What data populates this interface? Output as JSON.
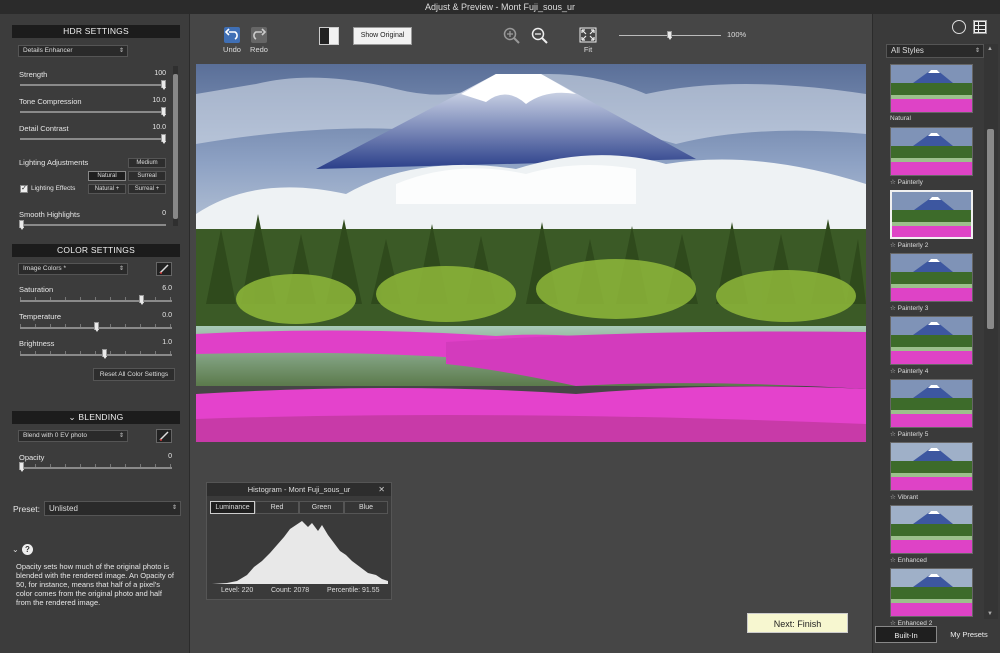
{
  "window": {
    "title": "Adjust & Preview - Mont Fuji_sous_ur"
  },
  "hdr": {
    "header": "HDR SETTINGS",
    "preset_dropdown": "Details Enhancer",
    "strength": {
      "label": "Strength",
      "value": "100",
      "level": 1.0
    },
    "tone_compression": {
      "label": "Tone Compression",
      "value": "10.0",
      "level": 1.0
    },
    "detail_contrast": {
      "label": "Detail Contrast",
      "value": "10.0",
      "level": 1.0
    },
    "lighting_adjustments": "Lighting Adjustments",
    "lighting_effects": "Lighting Effects",
    "lighting_buttons": [
      "Medium",
      "Natural",
      "Surreal",
      "Natural +",
      "Surreal +"
    ],
    "smooth_highlights": {
      "label": "Smooth Highlights",
      "value": "0",
      "level": 0.0
    }
  },
  "color": {
    "header": "COLOR SETTINGS",
    "dropdown": "Image Colors *",
    "saturation": {
      "label": "Saturation",
      "value": "6.0",
      "level": 0.8
    },
    "temperature": {
      "label": "Temperature",
      "value": "0.0",
      "level": 0.5
    },
    "brightness": {
      "label": "Brightness",
      "value": "1.0",
      "level": 0.55
    },
    "reset": "Reset All Color Settings"
  },
  "blending": {
    "header": "BLENDING",
    "header_icon": "chevron-down-icon",
    "dropdown": "Blend with 0 EV photo",
    "opacity": {
      "label": "Opacity",
      "value": "0",
      "level": 0.0
    }
  },
  "preset": {
    "label": "Preset:",
    "value": "Unlisted"
  },
  "help": {
    "text": "Opacity sets how much of the original photo is blended with the rendered image. An Opacity of 50, for instance, means that half of a pixel's color comes from the original photo and half from the rendered image."
  },
  "toolbar": {
    "undo": "Undo",
    "redo": "Redo",
    "show_original": "Show Original",
    "fit": "Fit",
    "zoom": "100%"
  },
  "histogram": {
    "title": "Histogram - Mont Fuji_sous_ur",
    "tabs": [
      "Luminance",
      "Red",
      "Green",
      "Blue"
    ],
    "level": "Level: 220",
    "count": "Count: 2078",
    "percentile": "Percentile: 91.55"
  },
  "next_button": "Next: Finish",
  "styles": {
    "dropdown": "All Styles",
    "items": [
      "Natural",
      "Painterly",
      "Painterly 2",
      "Painterly 3",
      "Painterly 4",
      "Painterly 5",
      "Vibrant",
      "Enhanced",
      "Enhanced 2"
    ],
    "tabs": [
      "Built-In",
      "My Presets"
    ]
  },
  "colors": {
    "accent_pink": "#e040c8",
    "next_bg": "#f7f7d0"
  }
}
